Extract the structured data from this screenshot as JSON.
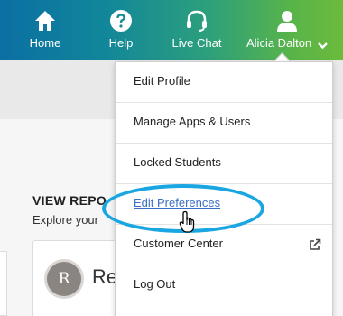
{
  "nav": {
    "items": [
      {
        "label": "Home",
        "icon": "home-icon"
      },
      {
        "label": "Help",
        "icon": "help-icon"
      },
      {
        "label": "Live Chat",
        "icon": "headset-icon"
      },
      {
        "label": "Alicia Dalton",
        "icon": "user-icon"
      }
    ]
  },
  "menu": {
    "items": [
      {
        "label": "Edit Profile"
      },
      {
        "label": "Manage Apps & Users"
      },
      {
        "label": "Locked Students"
      },
      {
        "label": "Edit Preferences",
        "highlighted": true
      },
      {
        "label": "Customer Center",
        "icon": "external-link-icon"
      },
      {
        "label": "Log Out"
      }
    ]
  },
  "page": {
    "section_title": "VIEW REPO",
    "section_subtitle": "Explore your"
  },
  "card": {
    "avatar_letter": "R",
    "title": "Re"
  },
  "colors": {
    "highlight": "#1aa6e0",
    "link": "#3b6fc4"
  }
}
